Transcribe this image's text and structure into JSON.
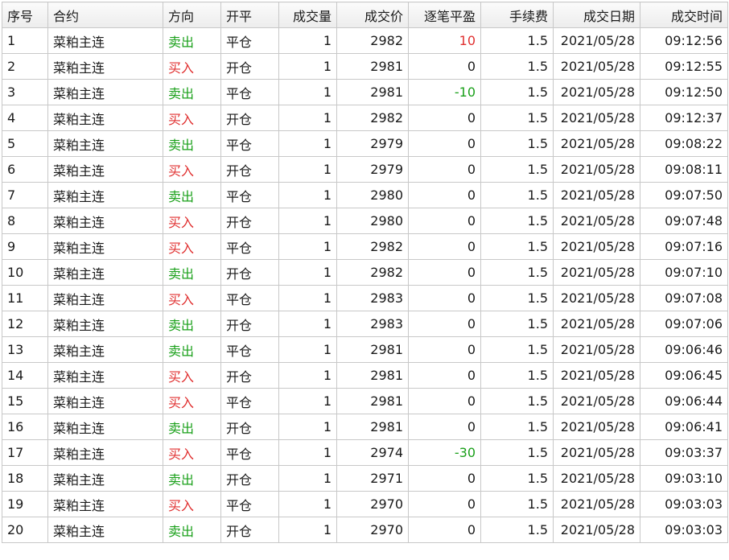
{
  "colors": {
    "sell": "#1aa01a",
    "buy": "#e03030",
    "profit": "#e03030",
    "loss": "#1aa01a"
  },
  "columns": [
    "序号",
    "合约",
    "方向",
    "开平",
    "成交量",
    "成交价",
    "逐笔平盈",
    "手续费",
    "成交日期",
    "成交时间"
  ],
  "rows": [
    {
      "no": "1",
      "contract": "菜粕主连",
      "dir": "卖出",
      "side": "sell",
      "oc": "平仓",
      "vol": "1",
      "price": "2982",
      "pnl": "10",
      "pnl_sign": "pos",
      "fee": "1.5",
      "date": "2021/05/28",
      "time": "09:12:56"
    },
    {
      "no": "2",
      "contract": "菜粕主连",
      "dir": "买入",
      "side": "buy",
      "oc": "开仓",
      "vol": "1",
      "price": "2981",
      "pnl": "0",
      "pnl_sign": "zero",
      "fee": "1.5",
      "date": "2021/05/28",
      "time": "09:12:55"
    },
    {
      "no": "3",
      "contract": "菜粕主连",
      "dir": "卖出",
      "side": "sell",
      "oc": "平仓",
      "vol": "1",
      "price": "2981",
      "pnl": "-10",
      "pnl_sign": "neg",
      "fee": "1.5",
      "date": "2021/05/28",
      "time": "09:12:50"
    },
    {
      "no": "4",
      "contract": "菜粕主连",
      "dir": "买入",
      "side": "buy",
      "oc": "开仓",
      "vol": "1",
      "price": "2982",
      "pnl": "0",
      "pnl_sign": "zero",
      "fee": "1.5",
      "date": "2021/05/28",
      "time": "09:12:37"
    },
    {
      "no": "5",
      "contract": "菜粕主连",
      "dir": "卖出",
      "side": "sell",
      "oc": "平仓",
      "vol": "1",
      "price": "2979",
      "pnl": "0",
      "pnl_sign": "zero",
      "fee": "1.5",
      "date": "2021/05/28",
      "time": "09:08:22"
    },
    {
      "no": "6",
      "contract": "菜粕主连",
      "dir": "买入",
      "side": "buy",
      "oc": "开仓",
      "vol": "1",
      "price": "2979",
      "pnl": "0",
      "pnl_sign": "zero",
      "fee": "1.5",
      "date": "2021/05/28",
      "time": "09:08:11"
    },
    {
      "no": "7",
      "contract": "菜粕主连",
      "dir": "卖出",
      "side": "sell",
      "oc": "平仓",
      "vol": "1",
      "price": "2980",
      "pnl": "0",
      "pnl_sign": "zero",
      "fee": "1.5",
      "date": "2021/05/28",
      "time": "09:07:50"
    },
    {
      "no": "8",
      "contract": "菜粕主连",
      "dir": "买入",
      "side": "buy",
      "oc": "开仓",
      "vol": "1",
      "price": "2980",
      "pnl": "0",
      "pnl_sign": "zero",
      "fee": "1.5",
      "date": "2021/05/28",
      "time": "09:07:48"
    },
    {
      "no": "9",
      "contract": "菜粕主连",
      "dir": "买入",
      "side": "buy",
      "oc": "平仓",
      "vol": "1",
      "price": "2982",
      "pnl": "0",
      "pnl_sign": "zero",
      "fee": "1.5",
      "date": "2021/05/28",
      "time": "09:07:16"
    },
    {
      "no": "10",
      "contract": "菜粕主连",
      "dir": "卖出",
      "side": "sell",
      "oc": "开仓",
      "vol": "1",
      "price": "2982",
      "pnl": "0",
      "pnl_sign": "zero",
      "fee": "1.5",
      "date": "2021/05/28",
      "time": "09:07:10"
    },
    {
      "no": "11",
      "contract": "菜粕主连",
      "dir": "买入",
      "side": "buy",
      "oc": "平仓",
      "vol": "1",
      "price": "2983",
      "pnl": "0",
      "pnl_sign": "zero",
      "fee": "1.5",
      "date": "2021/05/28",
      "time": "09:07:08"
    },
    {
      "no": "12",
      "contract": "菜粕主连",
      "dir": "卖出",
      "side": "sell",
      "oc": "开仓",
      "vol": "1",
      "price": "2983",
      "pnl": "0",
      "pnl_sign": "zero",
      "fee": "1.5",
      "date": "2021/05/28",
      "time": "09:07:06"
    },
    {
      "no": "13",
      "contract": "菜粕主连",
      "dir": "卖出",
      "side": "sell",
      "oc": "平仓",
      "vol": "1",
      "price": "2981",
      "pnl": "0",
      "pnl_sign": "zero",
      "fee": "1.5",
      "date": "2021/05/28",
      "time": "09:06:46"
    },
    {
      "no": "14",
      "contract": "菜粕主连",
      "dir": "买入",
      "side": "buy",
      "oc": "开仓",
      "vol": "1",
      "price": "2981",
      "pnl": "0",
      "pnl_sign": "zero",
      "fee": "1.5",
      "date": "2021/05/28",
      "time": "09:06:45"
    },
    {
      "no": "15",
      "contract": "菜粕主连",
      "dir": "买入",
      "side": "buy",
      "oc": "平仓",
      "vol": "1",
      "price": "2981",
      "pnl": "0",
      "pnl_sign": "zero",
      "fee": "1.5",
      "date": "2021/05/28",
      "time": "09:06:44"
    },
    {
      "no": "16",
      "contract": "菜粕主连",
      "dir": "卖出",
      "side": "sell",
      "oc": "开仓",
      "vol": "1",
      "price": "2981",
      "pnl": "0",
      "pnl_sign": "zero",
      "fee": "1.5",
      "date": "2021/05/28",
      "time": "09:06:41"
    },
    {
      "no": "17",
      "contract": "菜粕主连",
      "dir": "买入",
      "side": "buy",
      "oc": "平仓",
      "vol": "1",
      "price": "2974",
      "pnl": "-30",
      "pnl_sign": "neg",
      "fee": "1.5",
      "date": "2021/05/28",
      "time": "09:03:37"
    },
    {
      "no": "18",
      "contract": "菜粕主连",
      "dir": "卖出",
      "side": "sell",
      "oc": "开仓",
      "vol": "1",
      "price": "2971",
      "pnl": "0",
      "pnl_sign": "zero",
      "fee": "1.5",
      "date": "2021/05/28",
      "time": "09:03:10"
    },
    {
      "no": "19",
      "contract": "菜粕主连",
      "dir": "买入",
      "side": "buy",
      "oc": "平仓",
      "vol": "1",
      "price": "2970",
      "pnl": "0",
      "pnl_sign": "zero",
      "fee": "1.5",
      "date": "2021/05/28",
      "time": "09:03:03"
    },
    {
      "no": "20",
      "contract": "菜粕主连",
      "dir": "卖出",
      "side": "sell",
      "oc": "开仓",
      "vol": "1",
      "price": "2970",
      "pnl": "0",
      "pnl_sign": "zero",
      "fee": "1.5",
      "date": "2021/05/28",
      "time": "09:03:03"
    }
  ]
}
